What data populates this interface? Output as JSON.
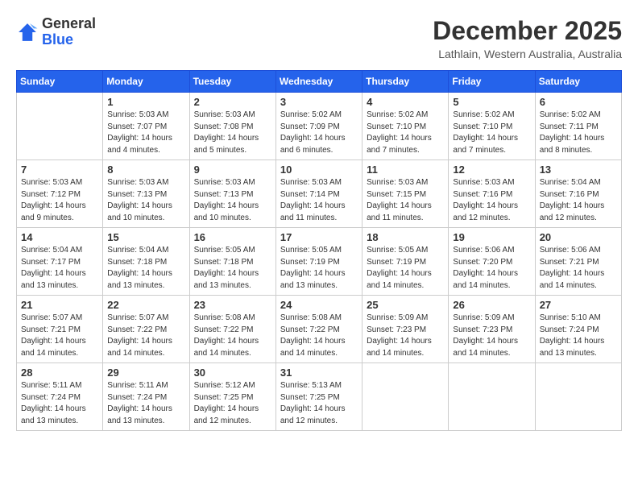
{
  "header": {
    "logo": {
      "line1": "General",
      "line2": "Blue"
    },
    "title": "December 2025",
    "location": "Lathlain, Western Australia, Australia"
  },
  "days_of_week": [
    "Sunday",
    "Monday",
    "Tuesday",
    "Wednesday",
    "Thursday",
    "Friday",
    "Saturday"
  ],
  "weeks": [
    [
      {
        "day": "",
        "content": ""
      },
      {
        "day": "1",
        "content": "Sunrise: 5:03 AM\nSunset: 7:07 PM\nDaylight: 14 hours\nand 4 minutes."
      },
      {
        "day": "2",
        "content": "Sunrise: 5:03 AM\nSunset: 7:08 PM\nDaylight: 14 hours\nand 5 minutes."
      },
      {
        "day": "3",
        "content": "Sunrise: 5:02 AM\nSunset: 7:09 PM\nDaylight: 14 hours\nand 6 minutes."
      },
      {
        "day": "4",
        "content": "Sunrise: 5:02 AM\nSunset: 7:10 PM\nDaylight: 14 hours\nand 7 minutes."
      },
      {
        "day": "5",
        "content": "Sunrise: 5:02 AM\nSunset: 7:10 PM\nDaylight: 14 hours\nand 7 minutes."
      },
      {
        "day": "6",
        "content": "Sunrise: 5:02 AM\nSunset: 7:11 PM\nDaylight: 14 hours\nand 8 minutes."
      }
    ],
    [
      {
        "day": "7",
        "content": "Sunrise: 5:03 AM\nSunset: 7:12 PM\nDaylight: 14 hours\nand 9 minutes."
      },
      {
        "day": "8",
        "content": "Sunrise: 5:03 AM\nSunset: 7:13 PM\nDaylight: 14 hours\nand 10 minutes."
      },
      {
        "day": "9",
        "content": "Sunrise: 5:03 AM\nSunset: 7:13 PM\nDaylight: 14 hours\nand 10 minutes."
      },
      {
        "day": "10",
        "content": "Sunrise: 5:03 AM\nSunset: 7:14 PM\nDaylight: 14 hours\nand 11 minutes."
      },
      {
        "day": "11",
        "content": "Sunrise: 5:03 AM\nSunset: 7:15 PM\nDaylight: 14 hours\nand 11 minutes."
      },
      {
        "day": "12",
        "content": "Sunrise: 5:03 AM\nSunset: 7:16 PM\nDaylight: 14 hours\nand 12 minutes."
      },
      {
        "day": "13",
        "content": "Sunrise: 5:04 AM\nSunset: 7:16 PM\nDaylight: 14 hours\nand 12 minutes."
      }
    ],
    [
      {
        "day": "14",
        "content": "Sunrise: 5:04 AM\nSunset: 7:17 PM\nDaylight: 14 hours\nand 13 minutes."
      },
      {
        "day": "15",
        "content": "Sunrise: 5:04 AM\nSunset: 7:18 PM\nDaylight: 14 hours\nand 13 minutes."
      },
      {
        "day": "16",
        "content": "Sunrise: 5:05 AM\nSunset: 7:18 PM\nDaylight: 14 hours\nand 13 minutes."
      },
      {
        "day": "17",
        "content": "Sunrise: 5:05 AM\nSunset: 7:19 PM\nDaylight: 14 hours\nand 13 minutes."
      },
      {
        "day": "18",
        "content": "Sunrise: 5:05 AM\nSunset: 7:19 PM\nDaylight: 14 hours\nand 14 minutes."
      },
      {
        "day": "19",
        "content": "Sunrise: 5:06 AM\nSunset: 7:20 PM\nDaylight: 14 hours\nand 14 minutes."
      },
      {
        "day": "20",
        "content": "Sunrise: 5:06 AM\nSunset: 7:21 PM\nDaylight: 14 hours\nand 14 minutes."
      }
    ],
    [
      {
        "day": "21",
        "content": "Sunrise: 5:07 AM\nSunset: 7:21 PM\nDaylight: 14 hours\nand 14 minutes."
      },
      {
        "day": "22",
        "content": "Sunrise: 5:07 AM\nSunset: 7:22 PM\nDaylight: 14 hours\nand 14 minutes."
      },
      {
        "day": "23",
        "content": "Sunrise: 5:08 AM\nSunset: 7:22 PM\nDaylight: 14 hours\nand 14 minutes."
      },
      {
        "day": "24",
        "content": "Sunrise: 5:08 AM\nSunset: 7:22 PM\nDaylight: 14 hours\nand 14 minutes."
      },
      {
        "day": "25",
        "content": "Sunrise: 5:09 AM\nSunset: 7:23 PM\nDaylight: 14 hours\nand 14 minutes."
      },
      {
        "day": "26",
        "content": "Sunrise: 5:09 AM\nSunset: 7:23 PM\nDaylight: 14 hours\nand 14 minutes."
      },
      {
        "day": "27",
        "content": "Sunrise: 5:10 AM\nSunset: 7:24 PM\nDaylight: 14 hours\nand 13 minutes."
      }
    ],
    [
      {
        "day": "28",
        "content": "Sunrise: 5:11 AM\nSunset: 7:24 PM\nDaylight: 14 hours\nand 13 minutes."
      },
      {
        "day": "29",
        "content": "Sunrise: 5:11 AM\nSunset: 7:24 PM\nDaylight: 14 hours\nand 13 minutes."
      },
      {
        "day": "30",
        "content": "Sunrise: 5:12 AM\nSunset: 7:25 PM\nDaylight: 14 hours\nand 12 minutes."
      },
      {
        "day": "31",
        "content": "Sunrise: 5:13 AM\nSunset: 7:25 PM\nDaylight: 14 hours\nand 12 minutes."
      },
      {
        "day": "",
        "content": ""
      },
      {
        "day": "",
        "content": ""
      },
      {
        "day": "",
        "content": ""
      }
    ]
  ]
}
